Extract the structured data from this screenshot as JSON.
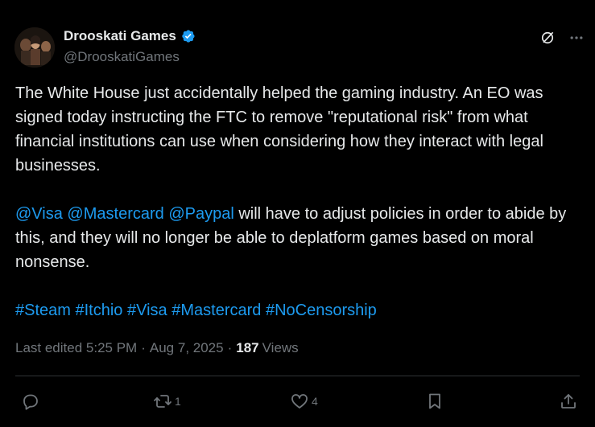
{
  "author": {
    "display_name": "Drooskati Games",
    "handle": "@DrooskatiGames",
    "verified": true
  },
  "post": {
    "paragraph1": "The White House just accidentally helped the gaming industry. An EO was signed today instructing the FTC to remove \"reputational risk\" from what financial institutions can use when considering how they interact with legal businesses.",
    "mentions": [
      "@Visa",
      "@Mastercard",
      "@Paypal"
    ],
    "paragraph2_rest": " will have to adjust policies in order to abide by this, and they will no longer be able to deplatform games based on moral nonsense.",
    "hashtags": [
      "#Steam",
      "#Itchio",
      "#Visa",
      "#Mastercard",
      "#NoCensorship"
    ]
  },
  "meta": {
    "edited": "Last edited 5:25 PM",
    "sep": "·",
    "date": "Aug 7, 2025",
    "views_count": "187",
    "views_label": "Views"
  },
  "actions": {
    "reply_count": "",
    "repost_count": "1",
    "like_count": "4"
  },
  "icons": {
    "verified": "verified-badge-icon",
    "grok": "grok-icon",
    "more": "more-icon",
    "reply": "reply-icon",
    "repost": "repost-icon",
    "like": "heart-icon",
    "bookmark": "bookmark-icon",
    "share": "share-icon"
  },
  "colors": {
    "background": "#000000",
    "text": "#e7e9ea",
    "muted": "#71767b",
    "link": "#1d9bf0"
  }
}
